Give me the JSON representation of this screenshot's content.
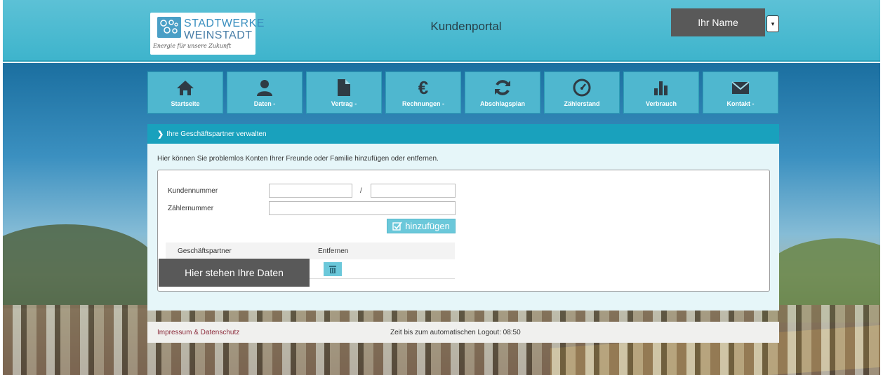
{
  "header": {
    "logo": {
      "name_line1": "STADTWERKE",
      "name_line2": "WEINSTADT",
      "tagline": "Energie für unsere Zukunft"
    },
    "title": "Kundenportal",
    "user_name": "Ihr Name"
  },
  "nav": {
    "items": [
      {
        "label": "Startseite",
        "icon": "home-icon"
      },
      {
        "label": "Daten -",
        "icon": "user-icon"
      },
      {
        "label": "Vertrag -",
        "icon": "document-icon"
      },
      {
        "label": "Rechnungen -",
        "icon": "euro-icon"
      },
      {
        "label": "Abschlagsplan",
        "icon": "refresh-icon"
      },
      {
        "label": "Zählerstand",
        "icon": "gauge-icon"
      },
      {
        "label": "Verbrauch",
        "icon": "bar-chart-icon"
      },
      {
        "label": "Kontakt -",
        "icon": "envelope-icon"
      }
    ]
  },
  "section": {
    "title": "Ihre Geschäftspartner verwalten",
    "intro": "Hier können Sie problemlos Konten Ihrer Freunde oder Familie hinzufügen oder entfernen.",
    "form": {
      "kundennummer_label": "Kundennummer",
      "slash": "/",
      "zaehlernummer_label": "Zählernummer",
      "kundennummer_value": "",
      "kundennummer_suffix_value": "",
      "zaehlernummer_value": "",
      "add_button": "hinzufügen"
    },
    "table": {
      "columns": [
        "Geschäftspartner",
        "Entfernen"
      ],
      "row_overlay": "Hier stehen Ihre Daten"
    }
  },
  "footer": {
    "imprint_link": "Impressum & Datenschutz",
    "logout_timer": "Zeit bis zum automatischen Logout: 08:50"
  },
  "colors": {
    "header": "#3eb4cc",
    "nav_tile": "#4fb7cf",
    "section_bar": "#19a1bd",
    "button": "#6bc8da",
    "overlay": "#595959",
    "imprint_link": "#8b2a3a"
  }
}
